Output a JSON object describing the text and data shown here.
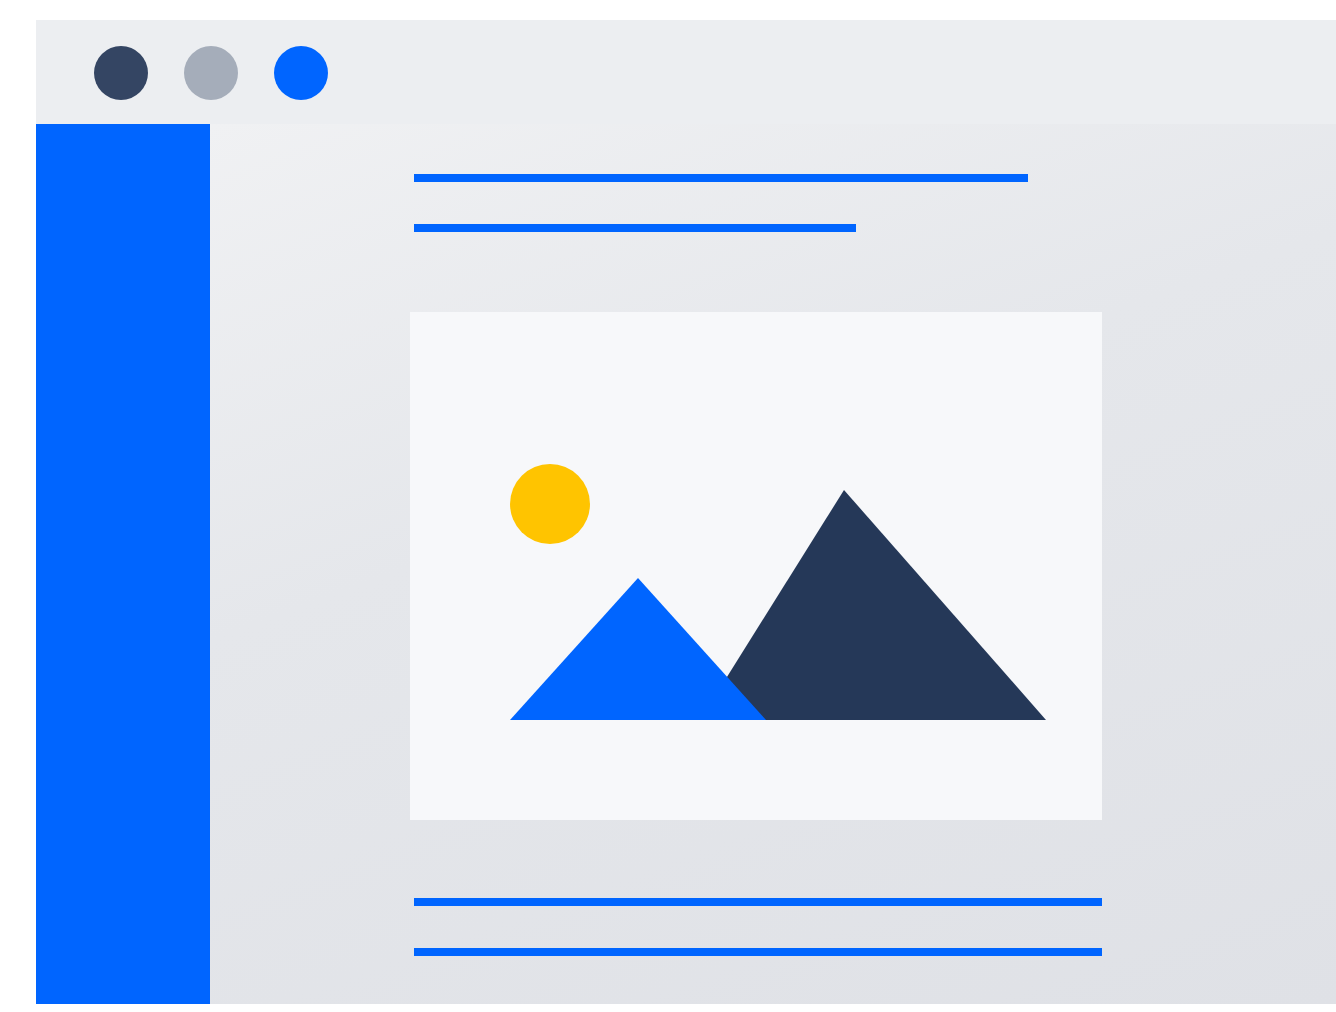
{
  "window": {
    "controls": [
      {
        "color": "#344563"
      },
      {
        "color": "#a5adba"
      },
      {
        "color": "#0065ff"
      }
    ]
  }
}
